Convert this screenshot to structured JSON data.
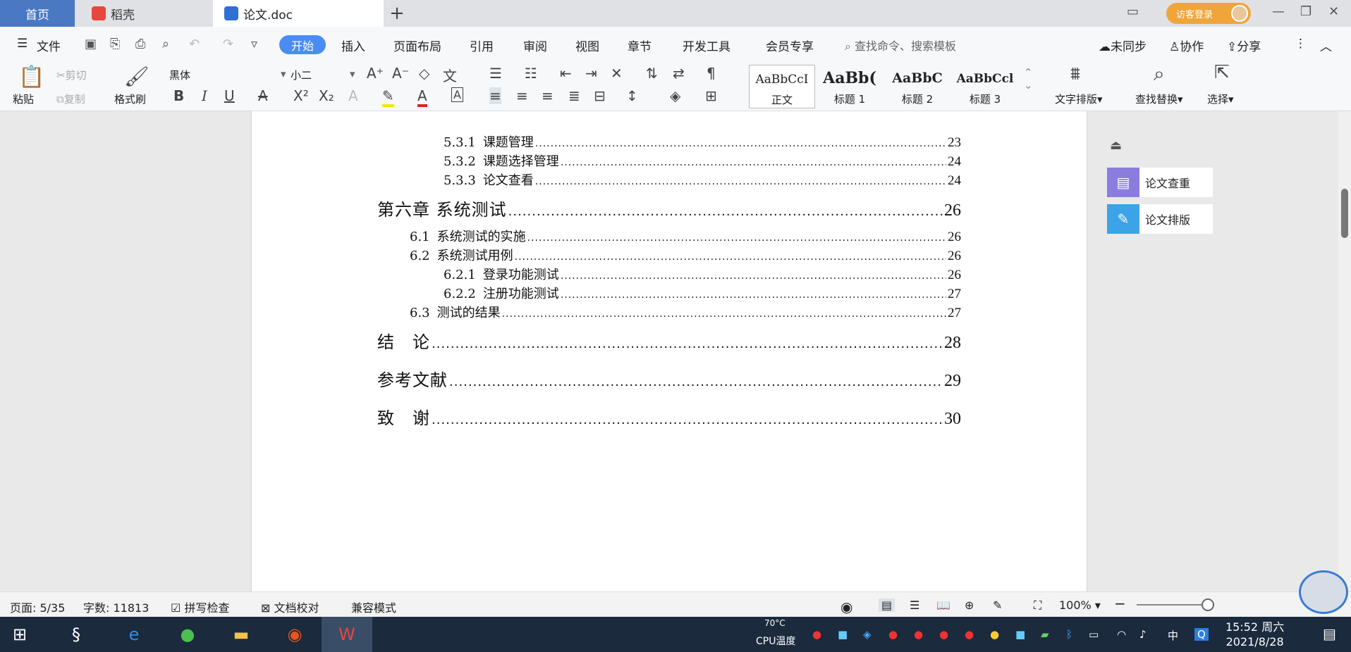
{
  "tabs": {
    "home": "首页",
    "daoke": "稻壳",
    "doc": "论文.doc",
    "new_tab": "+"
  },
  "window": {
    "login_label": "访客登录",
    "min": "—",
    "max": "❐",
    "close": "✕"
  },
  "menu": {
    "file": "文件",
    "start": "开始",
    "insert": "插入",
    "layout": "页面布局",
    "references": "引用",
    "review": "审阅",
    "view": "视图",
    "chapter": "章节",
    "dev": "开发工具",
    "member": "会员专享",
    "search": "查找命令、搜索模板",
    "sync": "未同步",
    "collab": "协作",
    "share": "分享"
  },
  "ribbon": {
    "paste": "粘贴",
    "cut": "剪切",
    "copy": "复制",
    "format_painter": "格式刷",
    "font": "黑体",
    "size": "小二",
    "styles": [
      {
        "preview": "AaBbCcI",
        "label": "正文"
      },
      {
        "preview": "AaBb(",
        "label": "标题 1"
      },
      {
        "preview": "AaBbC",
        "label": "标题 2"
      },
      {
        "preview": "AaBbCcl",
        "label": "标题 3"
      }
    ],
    "text_layout": "文字排版",
    "find_replace": "查找替换",
    "select": "选择"
  },
  "toc": [
    {
      "num": "5.3.1",
      "title": "课题管理",
      "page": "23"
    },
    {
      "num": "5.3.2",
      "title": "课题选择管理",
      "page": "24"
    },
    {
      "num": "5.3.3",
      "title": "论文查看",
      "page": "24"
    },
    {
      "num": "",
      "title": "第六章  系统测试",
      "page": "26"
    },
    {
      "num": "6.1",
      "title": "系统测试的实施",
      "page": "26"
    },
    {
      "num": "6.2",
      "title": "系统测试用例",
      "page": "26"
    },
    {
      "num": "6.2.1",
      "title": "登录功能测试",
      "page": "26"
    },
    {
      "num": "6.2.2",
      "title": "注册功能测试",
      "page": "27"
    },
    {
      "num": "6.3",
      "title": "测试的结果",
      "page": "27"
    },
    {
      "num": "",
      "title": "结　论",
      "page": "28"
    },
    {
      "num": "",
      "title": "参考文献",
      "page": "29"
    },
    {
      "num": "",
      "title": "致　谢",
      "page": "30"
    }
  ],
  "panel": {
    "check": "论文查重",
    "format": "论文排版"
  },
  "status": {
    "page": "页面: 5/35",
    "words": "字数: 11813",
    "spell": "拼写检查",
    "proof": "文档校对",
    "compat": "兼容模式",
    "zoom": "100%"
  },
  "taskbar": {
    "temp": "70°C",
    "cpu": "CPU温度",
    "ime": "中",
    "time": "15:52 周六",
    "date": "2021/8/28"
  },
  "colors": {
    "accent": "#4a8df2",
    "home_tab": "#4a78c2",
    "taskbar": "#1b2a3d"
  }
}
